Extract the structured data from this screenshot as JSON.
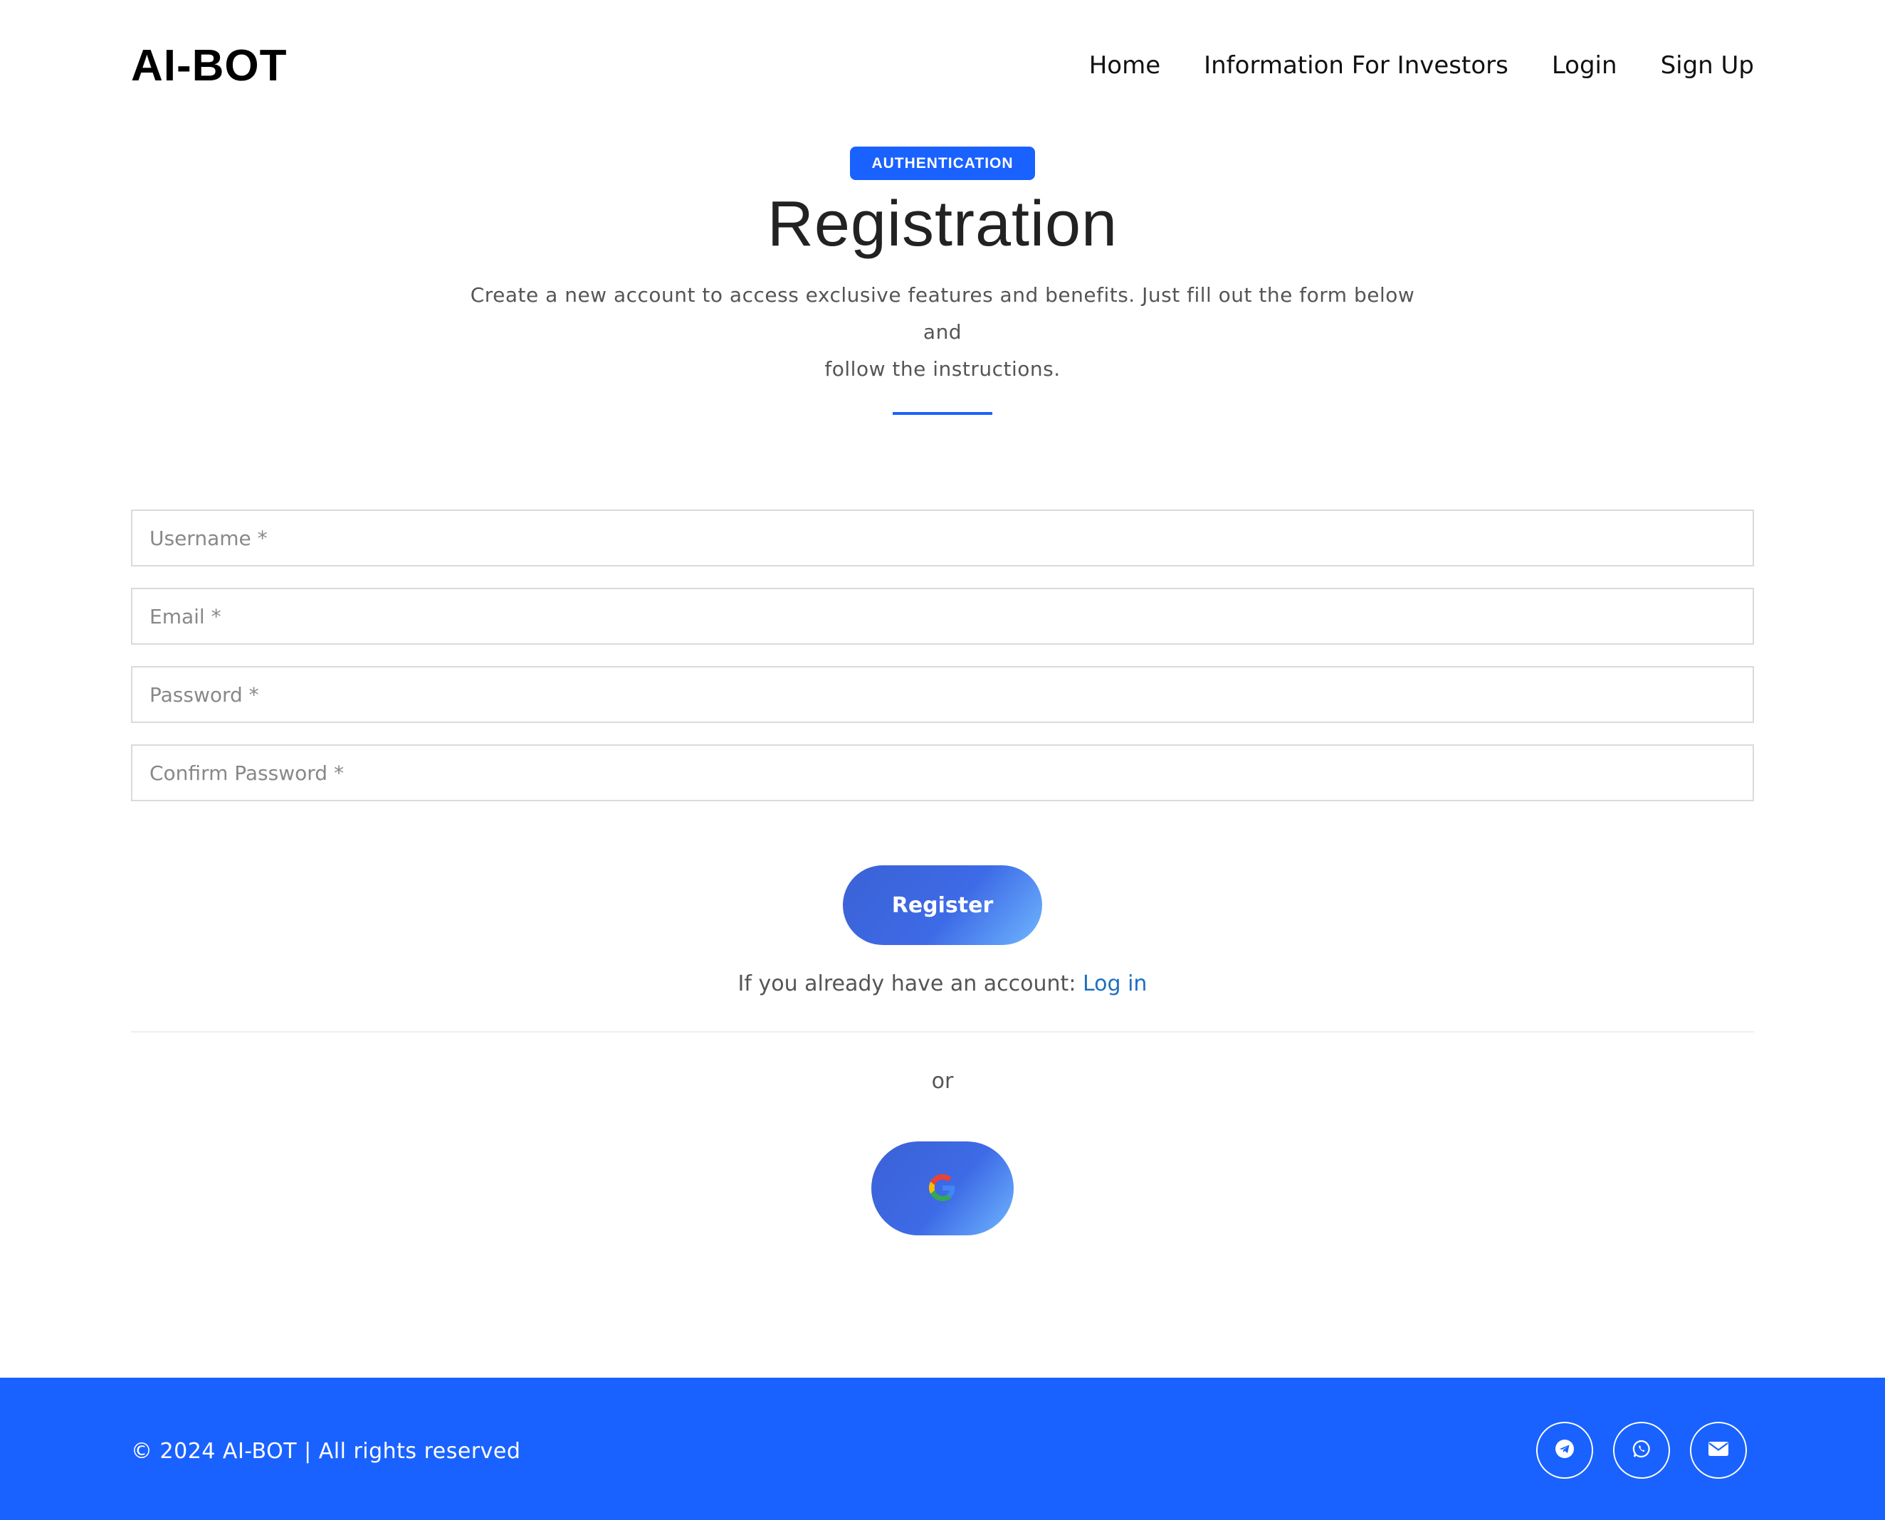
{
  "brand": {
    "logo": "AI-BOT"
  },
  "nav": {
    "items": [
      {
        "label": "Home"
      },
      {
        "label": "Information For Investors"
      },
      {
        "label": "Login"
      },
      {
        "label": "Sign Up"
      }
    ]
  },
  "hero": {
    "badge": "AUTHENTICATION",
    "title": "Registration",
    "subtitle_line1": "Create a new account to access exclusive features and benefits. Just fill out the form below and",
    "subtitle_line2": "follow the instructions."
  },
  "form": {
    "username_placeholder": "Username *",
    "email_placeholder": "Email *",
    "password_placeholder": "Password *",
    "confirm_password_placeholder": "Confirm Password *",
    "register_label": "Register"
  },
  "login_prompt": {
    "text": "If you already have an account:",
    "link_label": "Log in"
  },
  "separator": {
    "text": "or"
  },
  "social_login": {
    "icon": "google-icon"
  },
  "footer": {
    "copyright": "© 2024 AI-BOT | All rights reserved",
    "icons": [
      "telegram-icon",
      "whatsapp-icon",
      "envelope-icon"
    ]
  },
  "colors": {
    "accent": "#1a62ff",
    "link": "#1f6fbf",
    "button_gradient_start": "#3c62d6",
    "button_gradient_end": "#6fb6ff"
  }
}
